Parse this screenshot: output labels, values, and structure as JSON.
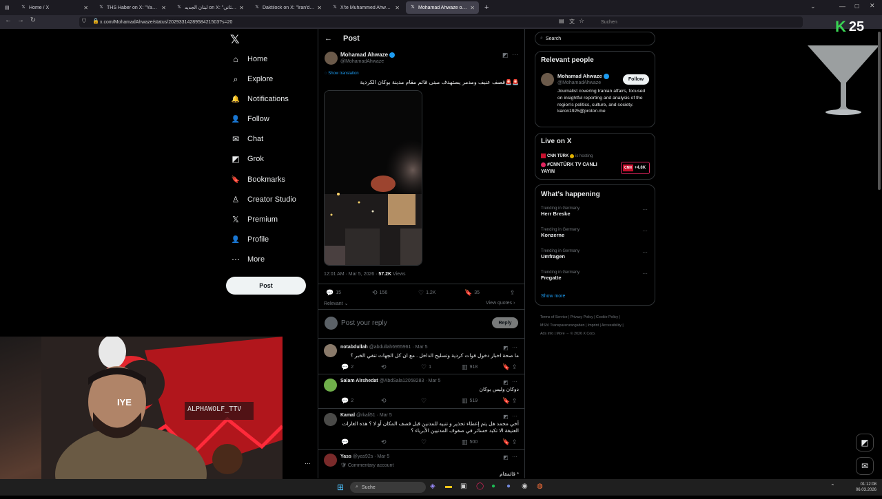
{
  "browser": {
    "tabs": [
      {
        "title": "Home / X",
        "active": false
      },
      {
        "title": "THS Haber on X: \"Yanıyor 🔥 !\"",
        "active": false
      },
      {
        "title": "لبنان الجديد on X: \"الثاني ...\"",
        "active": false
      },
      {
        "title": "Daktilock on X: \"İran'dan y...\"",
        "active": false
      },
      {
        "title": "X'te Muhammed Ahwaze: \"Zev...\"",
        "active": false
      },
      {
        "title": "Mohamad Ahwaze on X: \" \"",
        "active": true
      }
    ],
    "url": "x.com/MohamadAhwaze/status/2029331428958421503?s=20",
    "search_placeholder": "Suchen",
    "new_tab": "+"
  },
  "overlay": {
    "logo_letter": "K",
    "logo_number": "25"
  },
  "nav": {
    "items": [
      {
        "label": "Home",
        "icon": "⌂"
      },
      {
        "label": "Explore",
        "icon": "⌕"
      },
      {
        "label": "Notifications",
        "icon": "🔔"
      },
      {
        "label": "Follow",
        "icon": "👤"
      },
      {
        "label": "Chat",
        "icon": "✉"
      },
      {
        "label": "Grok",
        "icon": "◩"
      },
      {
        "label": "Bookmarks",
        "icon": "🔖"
      },
      {
        "label": "Creator Studio",
        "icon": "♙"
      },
      {
        "label": "Premium",
        "icon": "𝕏"
      },
      {
        "label": "Profile",
        "icon": "👤"
      },
      {
        "label": "More",
        "icon": "⋯"
      }
    ],
    "post_button": "Post",
    "logo": "𝕏"
  },
  "post": {
    "header": "Post",
    "author_name": "Mohamad Ahwaze",
    "author_handle": "@MohamadAhwaze",
    "show_translation": "Show translation",
    "text": "🚨🚨قصف عنيف ومدمر يستهدف مبنى قائم مقام مدينة بوكان الكردية",
    "timestamp": "12:01 AM · Mar 5, 2026 · ",
    "views_count": "57.2K",
    "views_label": " Views",
    "replies": "15",
    "reposts": "156",
    "likes": "1.2K",
    "bookmarks": "35",
    "sort": "Relevant",
    "view_quotes": "View quotes",
    "reply_placeholder": "Post your reply",
    "reply_button": "Reply"
  },
  "replies": [
    {
      "name": "notabdullah",
      "handle": "@abdullah6955961 · Mar 5",
      "text": "ما صحة اخبار دخول قوات كردية وتسليح الداخل . مع ان كل الجهات تنفي الخبر ؟",
      "replies": "2",
      "reposts": "",
      "likes": "1",
      "views": "918"
    },
    {
      "name": "Salam Alrshedat",
      "handle": "@AbdSala12058283 · Mar 5",
      "text": "دوكان وليس بوكان",
      "replies": "2",
      "reposts": "",
      "likes": "",
      "views": "519"
    },
    {
      "name": "Kamal",
      "handle": "@rkali51 · Mar 5",
      "text": "أخي محمد هل يتم إعطاء تحذير و تنبيه للمدنين قبل قصف المكان أو لا ؟ هذه الغارات العنيفة الا تكبد خسائر في صفوف المدنيين الأبرياء ؟",
      "replies": "",
      "reposts": "",
      "likes": "",
      "views": "500"
    },
    {
      "name": "Yass",
      "handle": "@yas92s · Mar 5",
      "sub": "🛡 Commentary account",
      "text": "* قائمقام"
    }
  ],
  "sidebar": {
    "search_placeholder": "Search",
    "relevant_title": "Relevant people",
    "person_name": "Mohamad Ahwaze",
    "person_handle": "@MohamadAhwaze",
    "follow": "Follow",
    "bio": "Journalist covering Iranian affairs, focused on insightful reporting and analysis of the region's politics, culture, and society. karon1925@proton.me",
    "live_title": "Live on X",
    "live_host": "CNN TÜRK",
    "live_hosting": "is hosting",
    "live_show": "#CNNTÜRK TV CANLI YAYIN",
    "live_count": "+4.8K",
    "live_badge": "CNN",
    "happening_title": "What's happening",
    "trends": [
      {
        "context": "Trending in Germany",
        "name": "Herr Breske"
      },
      {
        "context": "Trending in Germany",
        "name": "Konzerne"
      },
      {
        "context": "Trending in Germany",
        "name": "Umfragen"
      },
      {
        "context": "Trending in Germany",
        "name": "Fregatte"
      }
    ],
    "show_more": "Show more",
    "footer_line1": "Terms of Service  |  Privacy Policy  |  Cookie Policy  |",
    "footer_line2": "MStV Transparenzangaben  |  Imprint  |  Accessibility  |",
    "footer_line3": "Ads info  |  More ···  © 2026 X Corp."
  },
  "webcam": {
    "sign_text": "ALPHAWOLF_TTV",
    "flag_text": "IYE"
  },
  "taskbar": {
    "search": "Suche",
    "time": "01:12:08",
    "date": "06.03.2026"
  }
}
